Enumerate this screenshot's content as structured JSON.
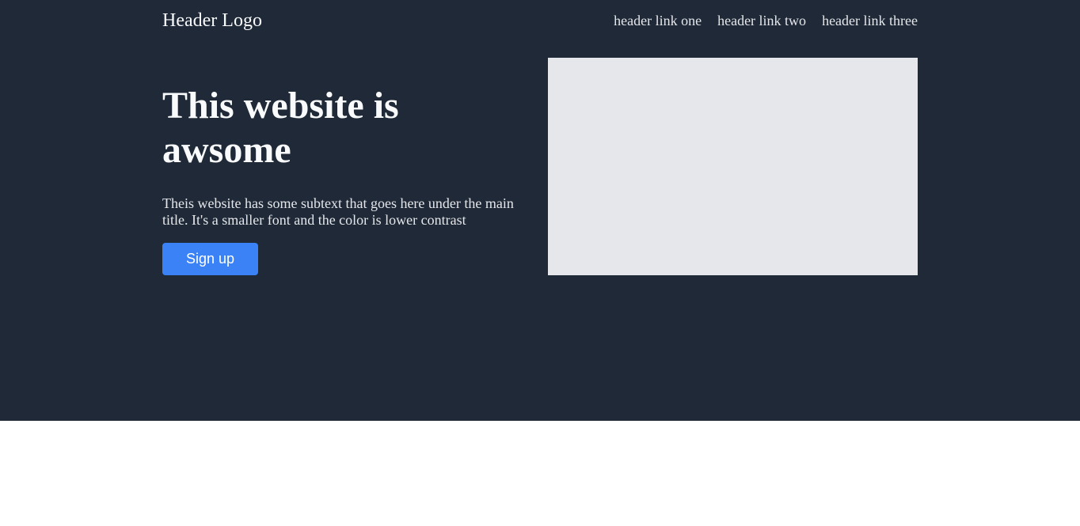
{
  "header": {
    "logo": "Header Logo",
    "links": [
      {
        "label": "header link one"
      },
      {
        "label": "header link two"
      },
      {
        "label": "header link three"
      }
    ]
  },
  "hero": {
    "title": "This website is awsome",
    "subtext": "Theis website has some subtext that goes here under the main title. It's a smaller font and the color is lower contrast",
    "cta_label": "Sign up"
  },
  "colors": {
    "hero_background": "#1f2937",
    "button_background": "#3b82f6",
    "image_placeholder": "#e5e7eb",
    "page_background": "#ffffff"
  }
}
